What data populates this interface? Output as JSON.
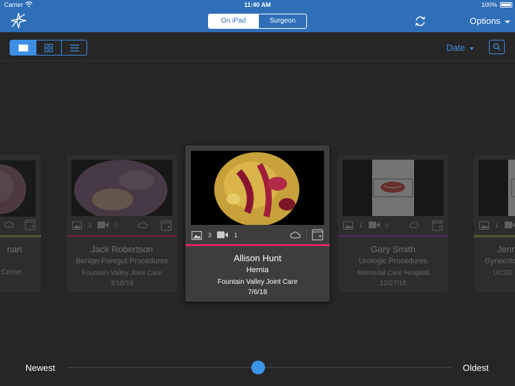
{
  "status_bar": {
    "carrier": "Carrier",
    "time": "11:40 AM",
    "battery": "100%"
  },
  "nav": {
    "segments": [
      {
        "label": "On iPad",
        "selected": true
      },
      {
        "label": "Surgeon Vault",
        "selected": false
      }
    ],
    "options_label": "Options",
    "logo_icon": "compass-star-logo",
    "sync_icon": "sync-icon"
  },
  "toolbar": {
    "view_modes": [
      {
        "icon": "single-card-view-icon",
        "selected": true
      },
      {
        "icon": "grid-view-icon",
        "selected": false
      },
      {
        "icon": "list-view-icon",
        "selected": false
      }
    ],
    "sort_label": "Date",
    "search_icon": "search-icon"
  },
  "cards": [
    {
      "name": "nan",
      "procedure": "",
      "location": "Center",
      "date": "",
      "accent": "#8fb83a"
    },
    {
      "name": "Jack Robertson",
      "procedure": "Benign Foregut Procedures",
      "location": "Fountain Valley Joint Care",
      "date": "3/18/19",
      "images": "3",
      "videos": "0",
      "accent": "#d61f52"
    },
    {
      "name": "Allison Hunt",
      "procedure": "Hernia",
      "location": "Fountain Valley Joint Care",
      "date": "7/6/18",
      "images": "3",
      "videos": "1",
      "accent": "#e0245e"
    },
    {
      "name": "Gary Smith",
      "procedure": "Urologic Procedures",
      "location": "Memorial Care Hospital",
      "date": "12/27/16",
      "images": "1",
      "videos": "0",
      "accent": "#7a2fb3"
    },
    {
      "name": "Jenn",
      "procedure": "Gynecolo",
      "location": "UCSD",
      "date": "",
      "images": "1",
      "accent": "#8fb83a"
    }
  ],
  "slider": {
    "left_label": "Newest",
    "right_label": "Oldest",
    "position": 0.5
  },
  "colors": {
    "nav_bg": "#2e6fb8",
    "accent_blue": "#3d8fe6",
    "bg": "#262626",
    "card_bg": "#3a3a3a"
  }
}
